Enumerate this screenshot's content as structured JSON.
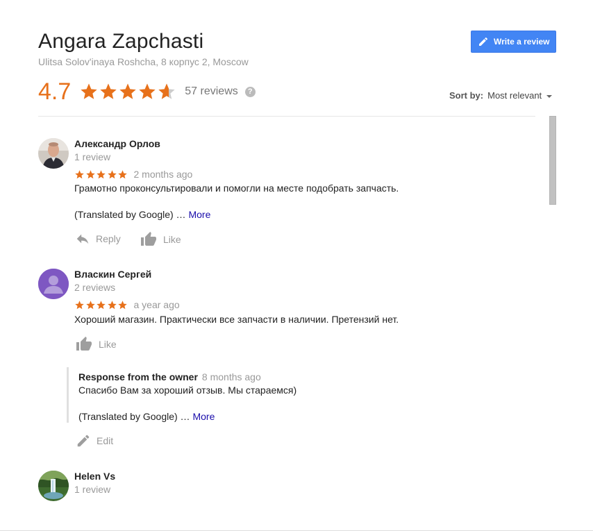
{
  "header": {
    "title": "Angara Zapchasti",
    "address": "Ulitsa Solov'inaya Roshcha, 8 корпус 2, Moscow",
    "write_review_label": "Write a review"
  },
  "summary": {
    "rating": "4.7",
    "rating_value": 4.7,
    "reviews_count": "57 reviews",
    "help": "?",
    "star_color": "#e7711b"
  },
  "sort": {
    "label": "Sort by:",
    "value": "Most relevant"
  },
  "reviews": [
    {
      "name": "Александр Орлов",
      "reviews": "1 review",
      "stars": 5,
      "date": "2 months ago",
      "text": "Грамотно проконсультировали и помогли на месте подобрать запчасть.",
      "translated": "(Translated by Google) … ",
      "more": "More",
      "reply": "Reply",
      "like": "Like"
    },
    {
      "name": "Власкин Сергей",
      "reviews": "2 reviews",
      "stars": 5,
      "date": "a year ago",
      "text": "Хороший магазин. Практически все запчасти в наличии. Претензий нет.",
      "like": "Like",
      "owner_response": {
        "title": "Response from the owner",
        "date": "8 months ago",
        "text": "Спасибо Вам за хороший отзыв. Мы стараемся)",
        "translated": "(Translated by Google) … ",
        "more": "More",
        "edit": "Edit"
      }
    },
    {
      "name": "Helen Vs",
      "reviews": "1 review"
    }
  ],
  "colors": {
    "accent_blue": "#4285f4",
    "link": "#1a0dab",
    "muted": "#999999",
    "avatar_purple": "#7e57c2"
  }
}
